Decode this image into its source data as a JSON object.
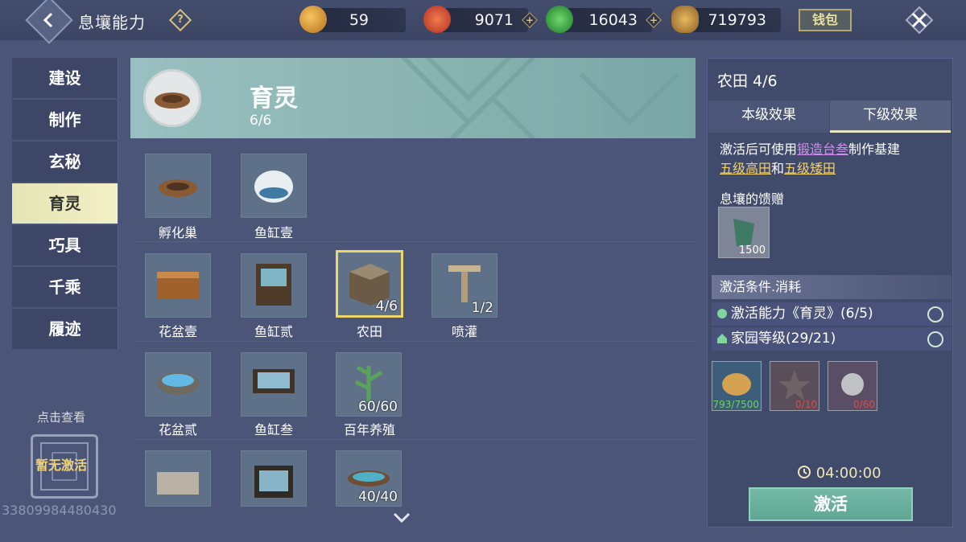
{
  "header": {
    "title": "息壤能力",
    "help_icon": "?",
    "wallet_label": "钱包"
  },
  "currencies": [
    {
      "icon": "gourd-coin-icon",
      "value": "59",
      "color": "#d49a3a"
    },
    {
      "icon": "red-swirl-icon",
      "value": "9071",
      "color": "#d4522e"
    },
    {
      "icon": "jade-coin-icon",
      "value": "16043",
      "color": "#3aa63a"
    },
    {
      "icon": "shell-icon",
      "value": "719793",
      "color": "#b0813a"
    }
  ],
  "nav": [
    "建设",
    "制作",
    "玄秘",
    "育灵",
    "巧具",
    "千乘",
    "履迹"
  ],
  "nav_active": "育灵",
  "side": {
    "hint": "点击查看",
    "status": "暂无激活",
    "uid": "33809984480430"
  },
  "banner": {
    "title": "育灵",
    "count": "6/6"
  },
  "items": [
    {
      "name": "孵化巢",
      "count": ""
    },
    {
      "name": "鱼缸壹",
      "count": ""
    },
    {
      "name": "花盆壹",
      "count": ""
    },
    {
      "name": "鱼缸贰",
      "count": ""
    },
    {
      "name": "农田",
      "count": "4/6",
      "selected": true
    },
    {
      "name": "喷灌",
      "count": "1/2"
    },
    {
      "name": "花盆贰",
      "count": ""
    },
    {
      "name": "鱼缸叁",
      "count": ""
    },
    {
      "name": "百年养殖",
      "count": "60/60"
    },
    {
      "name": "",
      "count": ""
    },
    {
      "name": "",
      "count": ""
    },
    {
      "name": "",
      "count": "40/40"
    }
  ],
  "detail": {
    "title": "农田 4/6",
    "tabs": [
      "本级效果",
      "下级效果"
    ],
    "active_tab": "下级效果",
    "desc_prefix": "激活后可使用",
    "desc_link1": "锻造台叁",
    "desc_mid": "制作基建",
    "desc_link2": "五级高田",
    "desc_and": "和",
    "desc_link3": "五级矮田",
    "gift_header": "息壤的馈赠",
    "gift_count": "1500",
    "cond_header": "激活条件.消耗",
    "conditions": [
      "激活能力《育灵》(6/5)",
      "家园等级(29/21)"
    ],
    "materials": [
      {
        "count": "793/7500",
        "color": "#6fd35c"
      },
      {
        "count": "0/10",
        "color": "#e04a4a"
      },
      {
        "count": "0/60",
        "color": "#e04a4a"
      }
    ],
    "timer": "04:00:00",
    "action_label": "激活"
  }
}
